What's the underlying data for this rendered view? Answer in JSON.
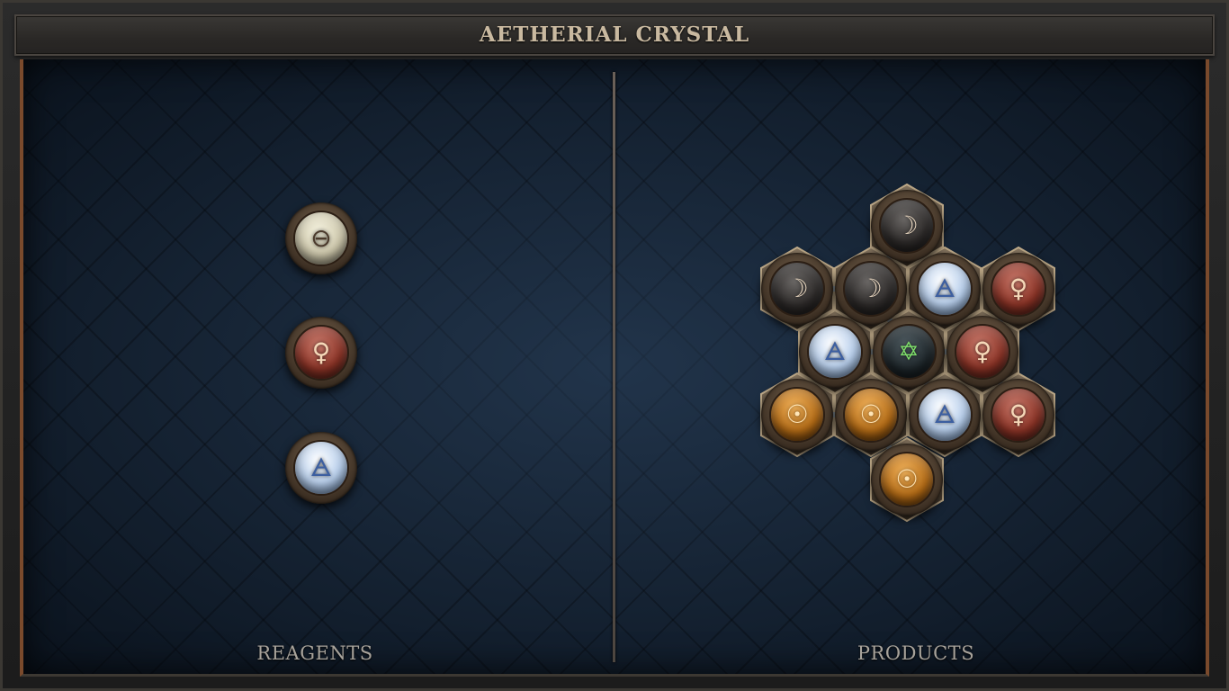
{
  "title": "AETHERIAL CRYSTAL",
  "panels": {
    "reagents_label": "REAGENTS",
    "products_label": "PRODUCTS"
  },
  "reagents": [
    {
      "element": "salt",
      "glyph": "⊖"
    },
    {
      "element": "copper",
      "glyph": "♀"
    },
    {
      "element": "air",
      "glyph": "🜁"
    }
  ],
  "product_atoms": [
    {
      "id": "top-lead",
      "element": "lead",
      "glyph": "☽"
    },
    {
      "id": "left-lead",
      "element": "lead",
      "glyph": "☽"
    },
    {
      "id": "inner-lead",
      "element": "lead",
      "glyph": "☽"
    },
    {
      "id": "upper-air",
      "element": "air",
      "glyph": "🜁"
    },
    {
      "id": "right-copper-top",
      "element": "copper",
      "glyph": "♀"
    },
    {
      "id": "left-air",
      "element": "air",
      "glyph": "🜁"
    },
    {
      "id": "center-quintessence",
      "element": "quintessence",
      "glyph": "✡"
    },
    {
      "id": "right-copper-mid",
      "element": "copper",
      "glyph": "♀"
    },
    {
      "id": "left-gold",
      "element": "gold",
      "glyph": "☉"
    },
    {
      "id": "inner-gold",
      "element": "gold",
      "glyph": "☉"
    },
    {
      "id": "lower-air",
      "element": "air",
      "glyph": "🜁"
    },
    {
      "id": "right-copper-bottom",
      "element": "copper",
      "glyph": "♀"
    },
    {
      "id": "bottom-gold",
      "element": "gold",
      "glyph": "☉"
    }
  ],
  "colors": {
    "board": "#152232",
    "frame_accent": "#7a4a2c",
    "title_text": "#c9b9a0",
    "label_text": "#a8a39b"
  }
}
